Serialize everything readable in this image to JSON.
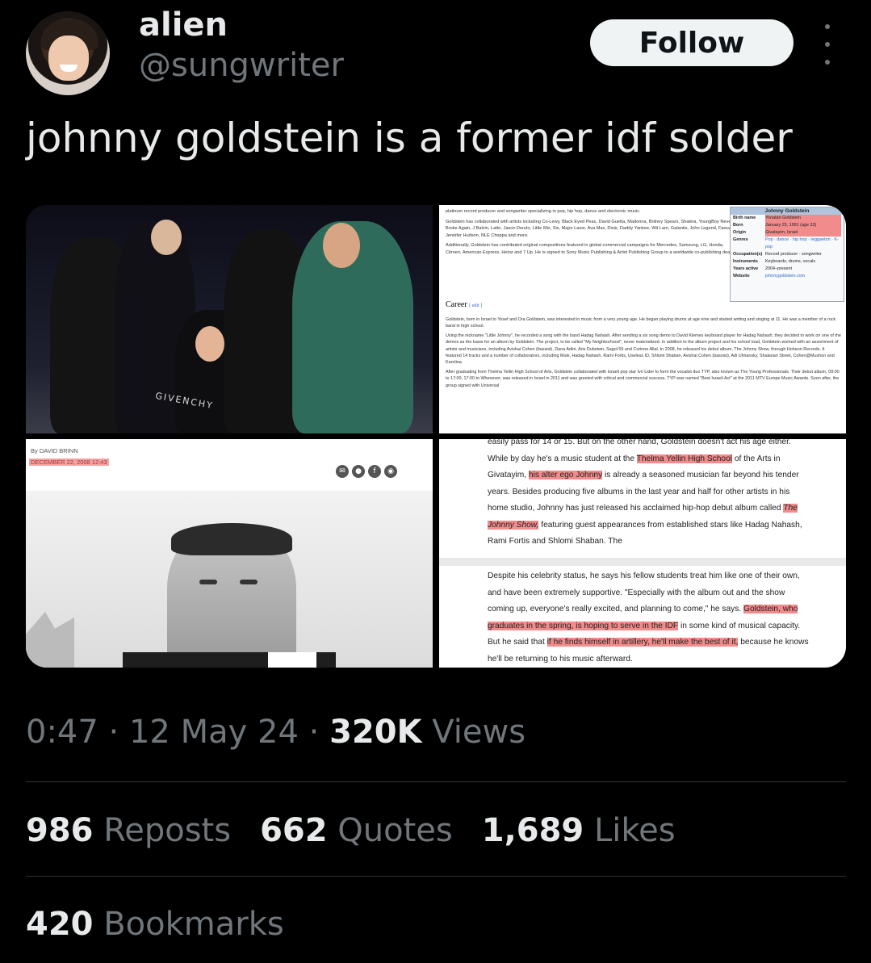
{
  "user": {
    "name": "alien",
    "handle": "@sungwriter",
    "follow_label": "Follow"
  },
  "tweet": {
    "text": "johnny goldstein is a former idf solder"
  },
  "media": {
    "photo_text": "GIVENCHY",
    "wiki": {
      "intro_1": "platinum record producer and songwriter specializing in pop, hip hop, dance and electronic music.",
      "intro_2": "Goldstein has collaborated with artists including Co-Lewy, Black Eyed Peas, David Guetta, Madonna, Britney Spears, Shakira, YoungBoy Never Broke Again, J Balvin, Latto, Jason Derulo, Little Mix, Six, Major Lazer, Ava Max, Dixie, Daddy Yankee, Wit Lam, Galantis, John Legend, Faouzia, Jennifer Hudson, NLE Choppa and more.",
      "intro_3": "Additionally, Goldstein has contributed original compositions featured in global commercial campaigns for Mercedes, Samsung, LG, Honda, Citroen, American Express, Heinz and 7 Up. He is signed to Sony Music Publishing & Artist Publishing Group to a worldwide co-publishing deal.",
      "box_title": "Johnny Goldstein",
      "box_rows": [
        {
          "k": "Birth name",
          "v": "Yonatan Goldstein"
        },
        {
          "k": "Born",
          "v": "January 25, 1991 (age 33)"
        },
        {
          "k": "Origin",
          "v": "Givatayim, Israel"
        },
        {
          "k": "Genres",
          "v": "Pop · dance · hip hop · reggaeton · K-pop"
        },
        {
          "k": "Occupation(s)",
          "v": "Record producer · songwriter"
        },
        {
          "k": "Instruments",
          "v": "Keyboards, drums, vocals"
        },
        {
          "k": "Years active",
          "v": "2004–present"
        },
        {
          "k": "Website",
          "v": "johnnygoldstein.com"
        }
      ],
      "career_heading": "Career",
      "edit": "[ edit ]",
      "career_1": "Goldstein, born in Israel to Yosef and Ora Goldstein, was interested in music from a very young age. He began playing drums at age nine and started writing and singing at 11. He was a member of a rock band in high school.",
      "career_2": "Using the nickname \"Little Johnny\", he recorded a song with the band Hadag Nahash. After sending a six song demo to David Klemes keyboard player for Hadag Nahash, they decided to work on one of the demos as the basis for an album by Goldstein. The project, to be called \"My Neighborhood\", never materialized. In addition to the album project and his school load, Goldstein worked with an assortment of artists and musicians, including Avishai Cohen (bassist), Dana Adini, Aris Dubstein, Sagol 59 and Corinne Allal. In 2008, he released his debut album, The Johnny Show, through Hoheon Records. It featured 14 tracks and a number of collaborators, including Muki, Hadag Nahash, Rami Fortis, Useless ID, Shlomi Shaban, Avishai Cohen (bassist), Adi Ulmansky, Shalanan Street, Cohen@Mushon and Karolina.",
      "career_3": "After graduating from Thelma Yellin High School of Arts, Goldstein collaborated with Israeli pop star Ivri Lider to form the vocalist duo TYP, also known as The Young Professionals. Their debut album, 09:00 to 17:00, 17:00 to Whenever, was released in Israel in 2011 and was greeted with critical and commercial success. TYP was named \"Best Israeli Act\" at the 2011 MTV Europe Music Awards. Soon after, the group signed with Universal"
    },
    "article": {
      "byline": "By DAVID BRINN",
      "date": "DECEMBER 22, 2008 12:43"
    },
    "excerpt": {
      "p1_a": "easily pass for 14 or 15. But on the other hand, Goldstein doesn't act his age either. While by day he's a music student at the ",
      "p1_hl1": "Thelma Yellin High School",
      "p1_b": " of the Arts in Givatayim, ",
      "p1_hl2": "his alter ego Johnny",
      "p1_c": " is already a seasoned musician far beyond his tender years. Besides producing five albums in the last year and half for other artists in his home studio, Johnny has just released his acclaimed hip-hop debut album called ",
      "p1_hl3": "The Johnny Show,",
      "p1_d": " featuring guest appearances from established stars like Hadag Nahash, Rami Fortis and Shlomi Shaban. The",
      "p2_a": "Despite his celebrity status, he says his fellow students treat him like one of their own, and have been extremely supportive. \"Especially with the album out and the show coming up, everyone's really excited, and planning to come,\" he says. ",
      "p2_hl1": "Goldstein, who graduates in the spring, is hoping to serve in the IDF",
      "p2_b": " in some kind of musical capacity. But he said that ",
      "p2_hl2": "if he finds himself in artillery, he'll make the best of it,",
      "p2_c": " because he knows he'll be returning to his music afterward."
    }
  },
  "meta": {
    "time": "0:47",
    "sep1": " · ",
    "date": "12 May 24",
    "sep2": " · ",
    "views_count": "320K",
    "views_label": " Views"
  },
  "stats": {
    "reposts_count": "986",
    "reposts_label": "Reposts",
    "quotes_count": "662",
    "quotes_label": "Quotes",
    "likes_count": "1,689",
    "likes_label": "Likes",
    "bookmarks_count": "420",
    "bookmarks_label": "Bookmarks"
  }
}
